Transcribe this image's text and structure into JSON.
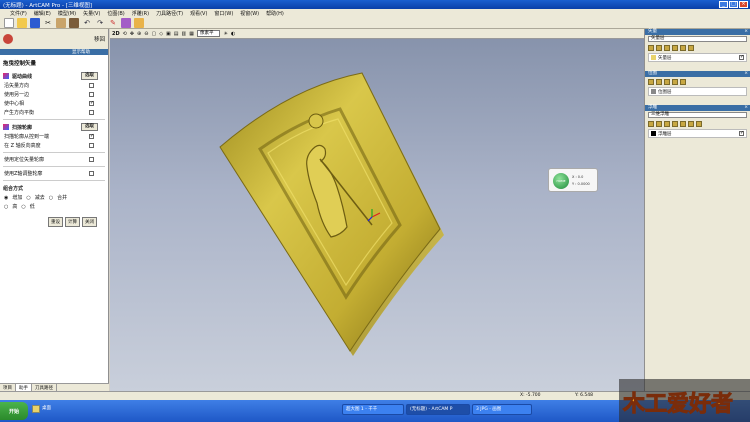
{
  "window": {
    "title": "(无标题) - ArtCAM Pro - [三维视图]",
    "controls": [
      "_",
      "□",
      "×"
    ]
  },
  "menubar": {
    "items": [
      "文件(F)",
      "编辑(E)",
      "模型(M)",
      "矢量(V)",
      "位图(B)",
      "浮雕(R)",
      "刀具路径(T)",
      "观看(V)",
      "窗口(W)",
      "视窗(W)",
      "帮助(H)"
    ]
  },
  "toolbar": {
    "icons": [
      "new-icon",
      "open-icon",
      "save-icon",
      "cut-icon",
      "copy-icon",
      "paste-icon",
      "undo-icon",
      "redo-icon",
      "draw-icon",
      "shape-icon",
      "calc-icon"
    ]
  },
  "left_panel": {
    "header_right": "移回",
    "subheader": "显示帮助",
    "title": "拖曳控制矢量",
    "section1": {
      "title": "驱动曲线",
      "button": "选取",
      "rows": [
        {
          "label": "沿矢量方向",
          "checked": false
        },
        {
          "label": "使用另一边",
          "checked": false
        },
        {
          "label": "使中心相",
          "checked": true
        },
        {
          "label": "产生方向平衡",
          "checked": false
        }
      ]
    },
    "section2": {
      "title": "扫掠轮廓",
      "button": "选取",
      "rows": [
        {
          "label": "扫描轮廓从控到一端",
          "checked": true
        },
        {
          "label": "在 Z 轴反向高度",
          "checked": false
        }
      ]
    },
    "rows3": [
      {
        "label": "使用定位矢量轮廓",
        "checked": false
      },
      {
        "label": "使用Z轴调整轮廓",
        "checked": false
      }
    ],
    "combine": {
      "title": "组合方式",
      "options": [
        "增加",
        "减去",
        "合并"
      ],
      "options2": [
        "高",
        "低"
      ]
    },
    "buttons": [
      "重设",
      "计算",
      "关闭"
    ],
    "tabs": [
      "项目",
      "助手",
      "刀具路径"
    ]
  },
  "viewport": {
    "view_label": "2D",
    "select_value": "像素平",
    "hud": {
      "disc": "HOME",
      "line1": "X : 0.0",
      "line2": "Y : 0.0000"
    }
  },
  "right_panel": {
    "sec1": {
      "title": "矢量",
      "dropdown": "矢量层",
      "item": "矢量层"
    },
    "sec2": {
      "title": "位图",
      "item": "位图层"
    },
    "sec3": {
      "title": "浮雕",
      "dropdown": "三维浮雕",
      "item": "浮雕层"
    }
  },
  "status": {
    "left": "",
    "x": "X: -5.700",
    "y": "Y: 6.548"
  },
  "taskbar": {
    "start": "开始",
    "quick": "桌面",
    "tasks": [
      "超大图 1 - 千千",
      "(无标题) - ArtCAM P",
      "3 JPG - 画图"
    ],
    "tray_text": "木工爱好者"
  },
  "colors": {
    "relief": "#c9b43a",
    "viewport_top": "#8591aa",
    "viewport_bottom": "#c9cfdb",
    "accent": "#3a6ea5"
  }
}
